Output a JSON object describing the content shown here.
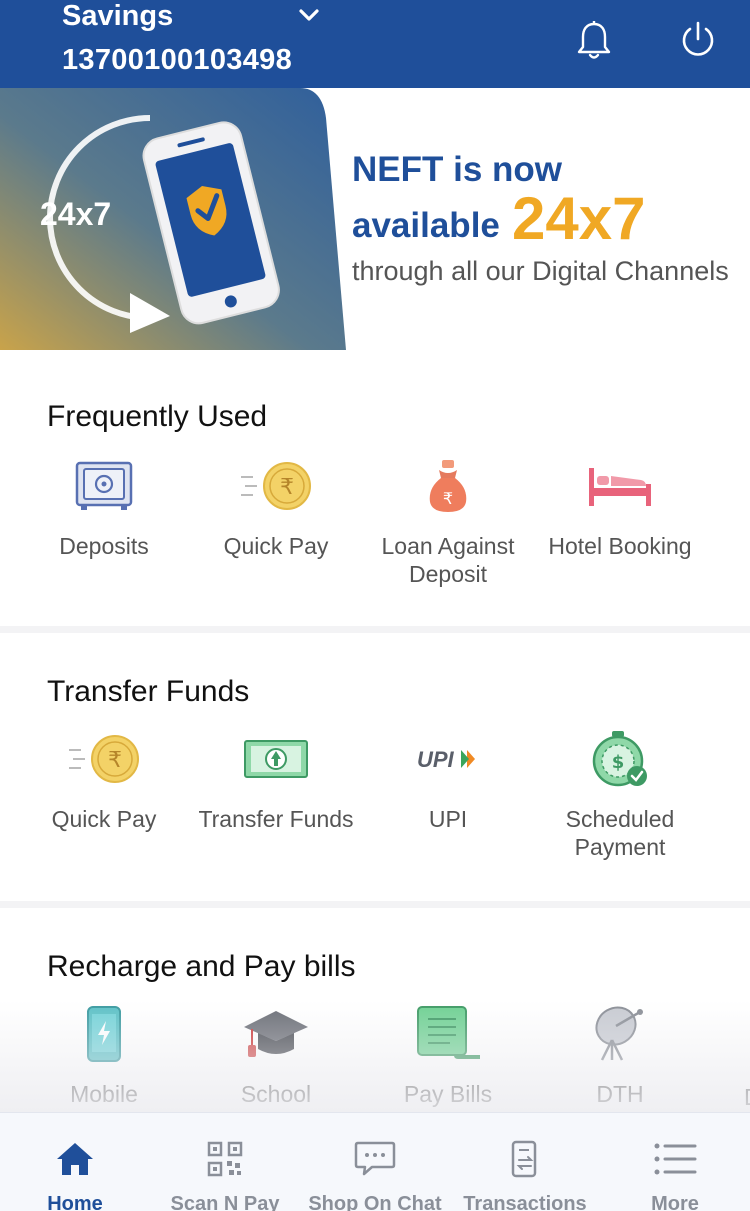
{
  "header": {
    "account_type": "Savings",
    "account_number": "13700100103498"
  },
  "banner": {
    "badge": "24x7",
    "line1": "NEFT is now",
    "line2": "available",
    "highlight": "24x7",
    "line3": "through all our Digital Channels"
  },
  "frequently_used": {
    "title": "Frequently Used",
    "items": [
      {
        "label": "Deposits",
        "icon": "safe-icon"
      },
      {
        "label": "Quick Pay",
        "icon": "rupee-coin-icon"
      },
      {
        "label": "Loan Against Deposit",
        "icon": "money-bag-icon"
      },
      {
        "label": "Hotel Booking",
        "icon": "bed-icon"
      }
    ]
  },
  "transfer_funds": {
    "title": "Transfer Funds",
    "items": [
      {
        "label": "Quick Pay",
        "icon": "rupee-coin-icon"
      },
      {
        "label": "Transfer Funds",
        "icon": "banknote-arrow-icon"
      },
      {
        "label": "UPI",
        "icon": "upi-logo-icon",
        "logo_text": "UPI"
      },
      {
        "label": "Scheduled Payment",
        "icon": "stopwatch-dollar-icon"
      }
    ]
  },
  "recharge": {
    "title": "Recharge and Pay bills",
    "items": [
      {
        "label": "Mobile",
        "icon": "mobile-icon"
      },
      {
        "label": "School",
        "icon": "graduation-cap-icon"
      },
      {
        "label": "Pay Bills",
        "icon": "bill-scroll-icon"
      },
      {
        "label": "DTH",
        "icon": "satellite-dish-icon"
      }
    ],
    "partial": "D"
  },
  "bottom_nav": {
    "items": [
      {
        "label": "Home",
        "icon": "home-icon",
        "active": true
      },
      {
        "label": "Scan N Pay",
        "icon": "qr-code-icon"
      },
      {
        "label": "Shop On Chat",
        "icon": "chat-icon"
      },
      {
        "label": "Transactions",
        "icon": "transactions-icon"
      },
      {
        "label": "More",
        "icon": "menu-list-icon"
      }
    ]
  },
  "colors": {
    "brand_blue": "#1f4f9a",
    "accent_orange": "#f0a824",
    "nav_inactive": "#8a8f99"
  }
}
